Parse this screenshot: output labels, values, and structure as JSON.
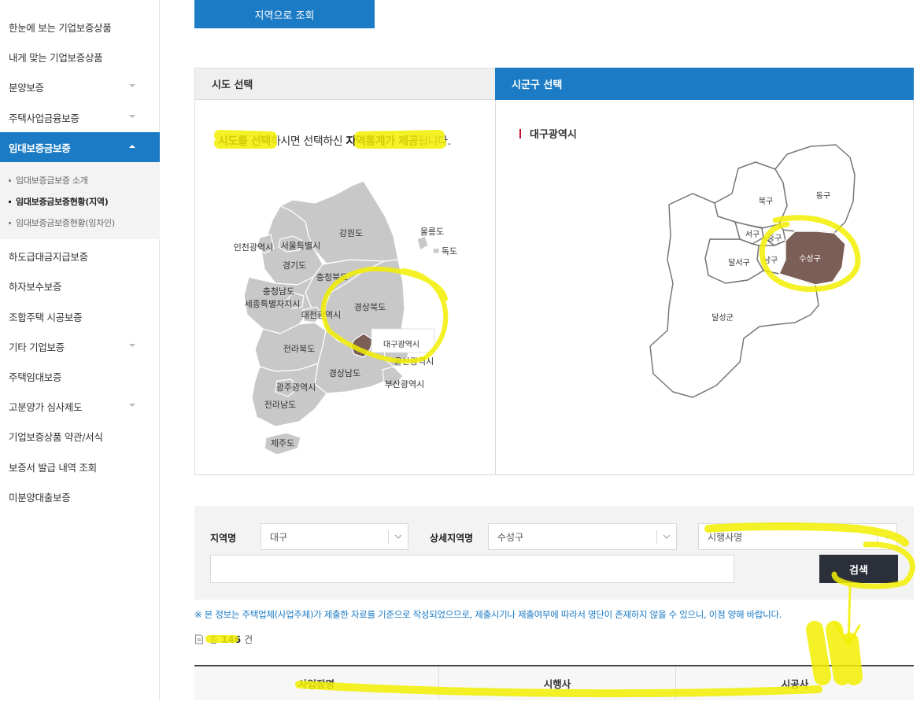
{
  "sidebar": {
    "items": [
      {
        "label": "한눈에 보는 기업보증상품"
      },
      {
        "label": "내게 맞는 기업보증상품"
      },
      {
        "label": "분양보증"
      },
      {
        "label": "주택사업금융보증"
      },
      {
        "label": "임대보증금보증"
      },
      {
        "label": "하도급대금지급보증"
      },
      {
        "label": "하자보수보증"
      },
      {
        "label": "조합주택 시공보증"
      },
      {
        "label": "기타 기업보증"
      },
      {
        "label": "주택임대보증"
      },
      {
        "label": "고분양가 심사제도"
      },
      {
        "label": "기업보증상품 약관/서식"
      },
      {
        "label": "보증서 발급 내역 조회"
      },
      {
        "label": "미분양대출보증"
      }
    ],
    "submenu": [
      {
        "label": "임대보증금보증 소개"
      },
      {
        "label": "임대보증금보증현황(지역)"
      },
      {
        "label": "임대보증금보증현황(임차인)"
      }
    ]
  },
  "top_button": {
    "label": "지역으로 조회"
  },
  "map": {
    "left_title": "시도 선택",
    "right_title": "시군구 선택",
    "instruction": {
      "p1": "시도를 선택",
      "p2": "하시면 선택하신 ",
      "p3": "지역통계가 제공",
      "p4": "됩니다."
    },
    "selected_city": "대구광역시",
    "provinces": {
      "gangwon": "강원도",
      "ulleung": "울릉도",
      "dokdo": "독도",
      "incheon": "인천광역시",
      "seoul": "서울특별시",
      "gyeonggi": "경기도",
      "chungbuk": "충청북도",
      "chungnam": "충청남도",
      "sejong": "세종특별자치시",
      "gyeongbuk": "경상북도",
      "daejeon": "대전광역시",
      "daegu": "대구광역시",
      "jeonbuk": "전라북도",
      "ulsan": "울산광역시",
      "gyeongnam": "경상남도",
      "busan": "부산광역시",
      "gwangju": "광주광역시",
      "jeonnam": "전라남도",
      "jeju": "제주도"
    },
    "districts": {
      "buk": "북구",
      "dong": "동구",
      "seo": "서구",
      "jung": "중구",
      "nam": "남구",
      "suseong": "수성구",
      "dalseo": "달서구",
      "dalseong": "달성군"
    }
  },
  "search": {
    "region_label": "지역명",
    "region_value": "대구",
    "detail_label": "상세지역명",
    "detail_value": "수성구",
    "developer_placeholder": "시행사명",
    "button": "검색"
  },
  "notice": "※ 본 정보는 주택업체(사업주체)가 제출한 자료를 기준으로 작성되었으므로, 제출시기나 제출여부에 따라서 명단이 존재하지 않을 수 있으니, 이점 양해 바랍니다.",
  "total": {
    "prefix": "총",
    "count": "146",
    "suffix": "건"
  },
  "table": {
    "columns": [
      "사업장명",
      "시행사",
      "시공사"
    ]
  },
  "colors": {
    "accent": "#1b7bc4",
    "selected_region": "#7b5e55",
    "highlight": "#f2f000",
    "dark_button": "#2b2f3a"
  }
}
